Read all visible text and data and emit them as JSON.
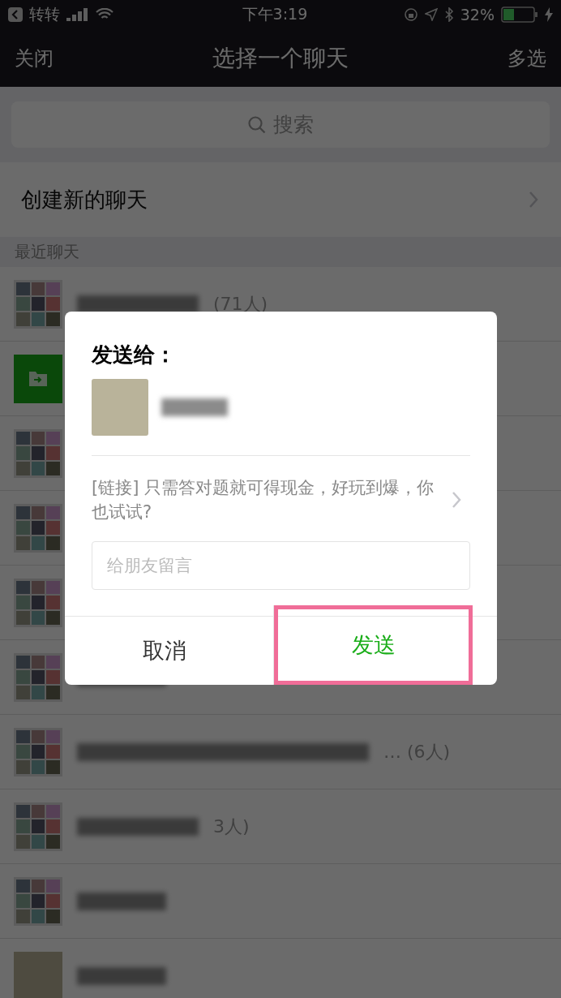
{
  "status_bar": {
    "back_app": "转转",
    "time": "下午3:19",
    "battery": "32%"
  },
  "nav": {
    "left": "关闭",
    "title": "选择一个聊天",
    "right": "多选"
  },
  "search": {
    "placeholder": "搜索"
  },
  "new_chat": {
    "label": "创建新的聊天"
  },
  "section": {
    "title": "最近聊天"
  },
  "chats": [
    {
      "kind": "group",
      "count": "(71人)"
    },
    {
      "kind": "folder",
      "name_shown": false
    },
    {
      "kind": "group",
      "name_shown": false
    },
    {
      "kind": "group",
      "name_shown": false
    },
    {
      "kind": "group",
      "name_shown": false
    },
    {
      "kind": "group"
    },
    {
      "kind": "group",
      "count": "… (6人)"
    },
    {
      "kind": "group",
      "count": "3人)"
    },
    {
      "kind": "group"
    },
    {
      "kind": "single"
    }
  ],
  "dialog": {
    "title": "发送给：",
    "message": "[链接] 只需答对题就可得现金，好玩到爆，你也试试?",
    "input": {
      "placeholder": "给朋友留言"
    },
    "buttons": [
      {
        "label": "取消",
        "kind": "cancel",
        "highlighted": false
      },
      {
        "label": "发送",
        "kind": "confirm",
        "highlighted": true
      }
    ]
  }
}
